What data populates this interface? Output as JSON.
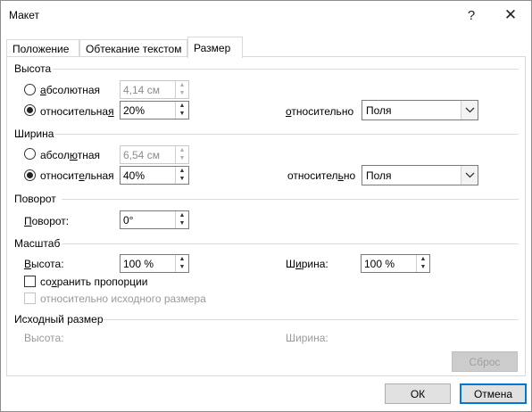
{
  "window": {
    "title": "Макет",
    "help_glyph": "?",
    "close_glyph": "✕"
  },
  "tabs": [
    {
      "label": "Положение",
      "active": false
    },
    {
      "label": "Обтекание текстом",
      "active": false
    },
    {
      "label": "Размер",
      "active": true
    }
  ],
  "height_section": {
    "title": "Высота",
    "absolute_label": "абсолютная",
    "absolute_value": "4,14 см",
    "relative_label_pre": "относительна",
    "relative_label_u": "я",
    "relative_value": "20%",
    "relative_to_label_pre": "о",
    "relative_to_label_rest": "тносительно",
    "relative_to_value": "Поля",
    "selected": "relative"
  },
  "width_section": {
    "title": "Ширина",
    "absolute_label_pre": "абсол",
    "absolute_label_u": "ю",
    "absolute_label_rest": "тная",
    "absolute_value": "6,54 см",
    "relative_label_pre": "относит",
    "relative_label_u": "е",
    "relative_label_rest": "льная",
    "relative_value": "40%",
    "relative_to_label_pre": "относител",
    "relative_to_label_u": "ь",
    "relative_to_label_rest": "но",
    "relative_to_value": "Поля",
    "selected": "relative"
  },
  "rotation_section": {
    "title": "Поворот",
    "rotation_label_u": "П",
    "rotation_label_rest": "оворот:",
    "rotation_value": "0°"
  },
  "scale_section": {
    "title": "Масштаб",
    "height_label_u": "В",
    "height_label_rest": "ысота:",
    "height_value": "100 %",
    "width_label_pre": "Ш",
    "width_label_u": "и",
    "width_label_rest": "рина:",
    "width_value": "100 %",
    "lock_ratio_label_pre": "со",
    "lock_ratio_label_u": "х",
    "lock_ratio_label_rest": "ранить пропорции",
    "lock_ratio_checked": false,
    "relative_original_label": "относительно исходного размера",
    "relative_original_checked": false
  },
  "original_section": {
    "title": "Исходный размер",
    "height_label": "Высота:",
    "width_label": "Ширина:",
    "reset_label": "Сброс"
  },
  "footer": {
    "ok_label": "ОК",
    "cancel_label": "Отмена"
  },
  "arrows": {
    "up": "▲",
    "down": "▼",
    "dropdown": "⌵"
  }
}
